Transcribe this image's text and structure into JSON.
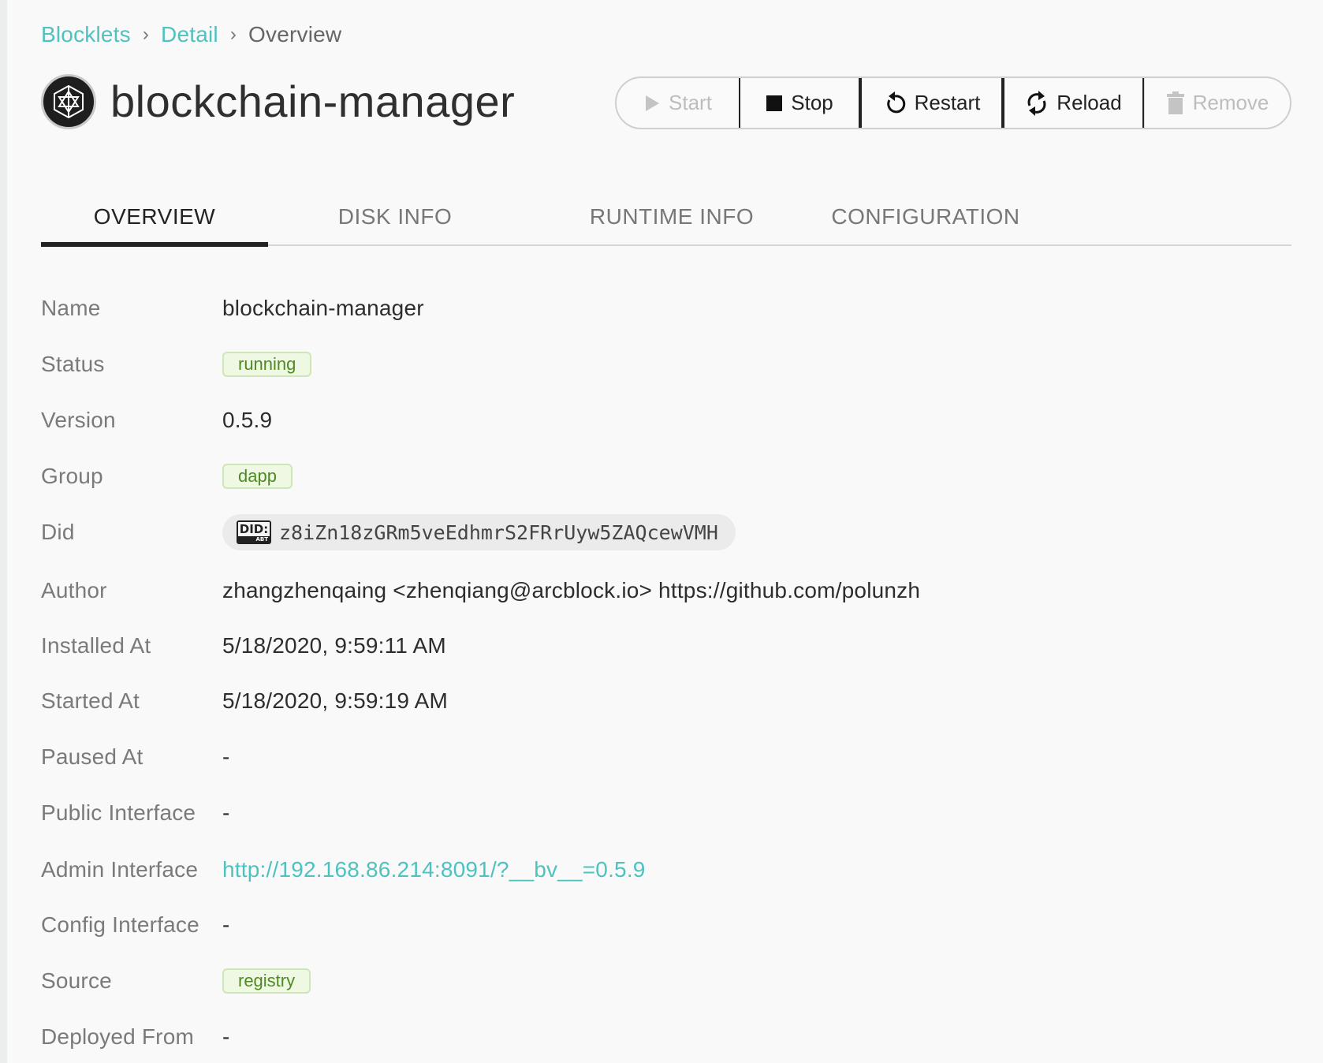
{
  "breadcrumb": {
    "items": [
      {
        "label": "Blocklets"
      },
      {
        "label": "Detail"
      },
      {
        "label": "Overview"
      }
    ],
    "separator": "›"
  },
  "header": {
    "title": "blockchain-manager",
    "logo_icon": "blocklet-logo-icon"
  },
  "actions": {
    "start": {
      "label": "Start",
      "icon": "play-icon",
      "enabled": false
    },
    "stop": {
      "label": "Stop",
      "icon": "stop-icon",
      "enabled": true
    },
    "restart": {
      "label": "Restart",
      "icon": "restart-icon",
      "enabled": true
    },
    "reload": {
      "label": "Reload",
      "icon": "reload-icon",
      "enabled": true
    },
    "remove": {
      "label": "Remove",
      "icon": "trash-icon",
      "enabled": false
    }
  },
  "tabs": [
    {
      "label": "OVERVIEW",
      "selected": true
    },
    {
      "label": "DISK INFO",
      "selected": false
    },
    {
      "label": "RUNTIME INFO",
      "selected": false
    },
    {
      "label": "CONFIGURATION",
      "selected": false
    }
  ],
  "details": {
    "name": {
      "label": "Name",
      "value": "blockchain-manager"
    },
    "status": {
      "label": "Status",
      "value": "running"
    },
    "version": {
      "label": "Version",
      "value": "0.5.9"
    },
    "group": {
      "label": "Group",
      "value": "dapp"
    },
    "did": {
      "label": "Did",
      "badge_top": "DID:",
      "badge_bottom": "ABT",
      "value": "z8iZn18zGRm5veEdhmrS2FRrUyw5ZAQcewVMH"
    },
    "author": {
      "label": "Author",
      "value": "zhangzhenqaing <zhenqiang@arcblock.io> https://github.com/polunzh"
    },
    "installed_at": {
      "label": "Installed At",
      "value": "5/18/2020, 9:59:11 AM"
    },
    "started_at": {
      "label": "Started At",
      "value": "5/18/2020, 9:59:19 AM"
    },
    "paused_at": {
      "label": "Paused At",
      "value": "-"
    },
    "public_interface": {
      "label": "Public Interface",
      "value": "-"
    },
    "admin_interface": {
      "label": "Admin Interface",
      "value": "http://192.168.86.214:8091/?__bv__=0.5.9"
    },
    "config_interface": {
      "label": "Config Interface",
      "value": "-"
    },
    "source": {
      "label": "Source",
      "value": "registry"
    },
    "deployed_from": {
      "label": "Deployed From",
      "value": "-"
    }
  },
  "colors": {
    "accent": "#4fc2c0",
    "tag_bg": "#eef8e3",
    "tag_text": "#4f8a24",
    "tag_border": "#cfe6b8"
  }
}
